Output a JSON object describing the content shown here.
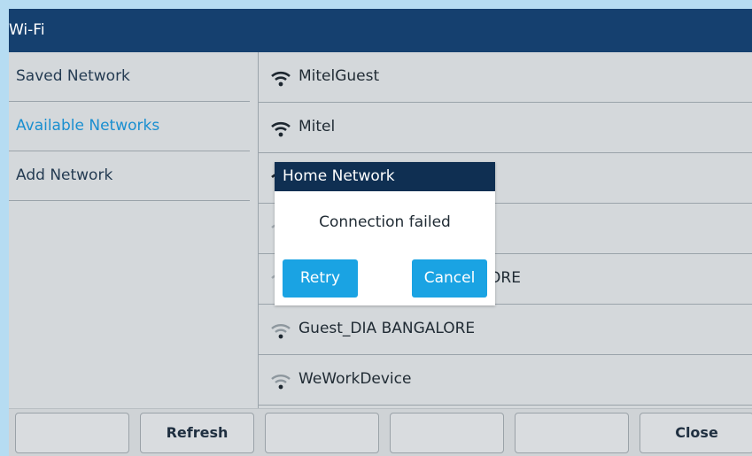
{
  "window": {
    "title": "Wi-Fi"
  },
  "sidebar": {
    "items": [
      {
        "label": "Saved Network",
        "active": false
      },
      {
        "label": "Available Networks",
        "active": true
      },
      {
        "label": "Add Network",
        "active": false
      }
    ]
  },
  "networks": [
    {
      "name": "MitelGuest",
      "icon": "wifi-strong-icon"
    },
    {
      "name": "Mitel",
      "icon": "wifi-strong-icon"
    },
    {
      "name": "",
      "icon": "wifi-strong-icon"
    },
    {
      "name": "",
      "icon": "wifi-weak-icon"
    },
    {
      "name": "ORE",
      "icon": "wifi-weak-icon"
    },
    {
      "name": "Guest_DIA BANGALORE",
      "icon": "wifi-weak-icon"
    },
    {
      "name": "WeWorkDevice",
      "icon": "wifi-weak-icon"
    }
  ],
  "softkeys": [
    "",
    "Refresh",
    "",
    "",
    "",
    "Close"
  ],
  "dialog": {
    "title": "Home Network",
    "message": "Connection failed",
    "retry_label": "Retry",
    "cancel_label": "Cancel"
  },
  "colors": {
    "titlebar": "#15406f",
    "accent": "#1a8fd0",
    "dialog_button": "#1aa3e3",
    "dialog_title": "#0f2f52"
  }
}
